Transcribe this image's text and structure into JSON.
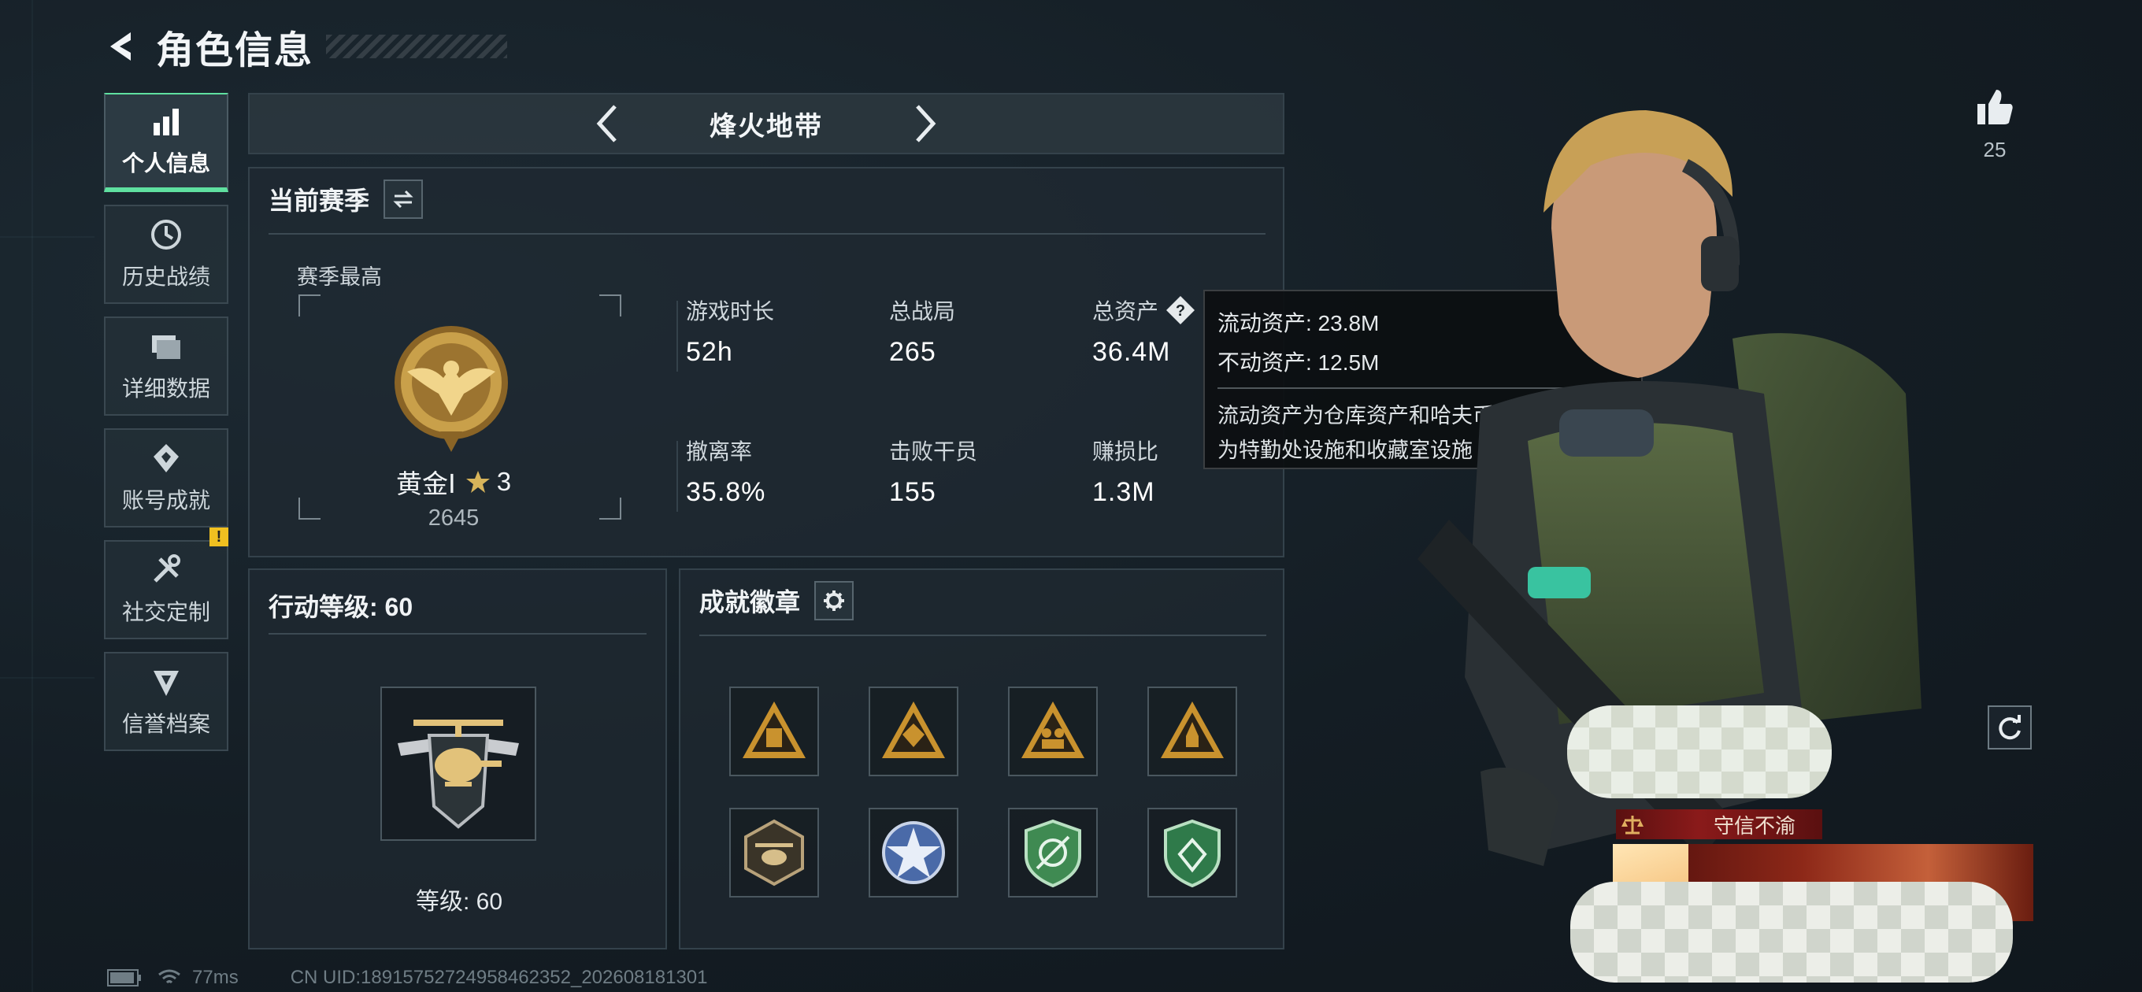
{
  "header": {
    "title": "角色信息"
  },
  "sidebar": {
    "items": [
      {
        "label": "个人信息",
        "icon": "bar-chart-icon",
        "active": true
      },
      {
        "label": "历史战绩",
        "icon": "clock-icon"
      },
      {
        "label": "详细数据",
        "icon": "folder-icon"
      },
      {
        "label": "账号成就",
        "icon": "achievement-icon"
      },
      {
        "label": "社交定制",
        "icon": "tools-icon",
        "badge": "!"
      },
      {
        "label": "信誉档案",
        "icon": "reputation-icon"
      }
    ]
  },
  "mode": {
    "name": "烽火地带"
  },
  "season": {
    "title": "当前赛季",
    "best_label": "赛季最高",
    "rank_name": "黄金Ⅰ",
    "rank_stars": "3",
    "rank_score": "2645",
    "stats": [
      {
        "label": "游戏时长",
        "value": "52h"
      },
      {
        "label": "总战局",
        "value": "265"
      },
      {
        "label": "总资产",
        "value": "36.4M"
      },
      {
        "label": "撤离率",
        "value": "35.8%"
      },
      {
        "label": "击败干员",
        "value": "155"
      },
      {
        "label": "赚损比",
        "value": "1.3M"
      }
    ]
  },
  "tooltip": {
    "liquid": "流动资产: 23.8M",
    "fixed": "不动资产: 12.5M",
    "desc_line1": "流动资产为仓库资产和哈夫币，不动资产",
    "desc_line2": "为特勤处设施和收藏室设施"
  },
  "level": {
    "title": "行动等级: 60",
    "label": "等级: 60"
  },
  "badges": {
    "title": "成就徽章"
  },
  "right": {
    "likes": "25",
    "tag": "守信不渝"
  },
  "footer": {
    "ping": "77ms",
    "uid": "CN UID:18915752724958462352_202608181301"
  },
  "colors": {
    "accent": "#5fe0a0",
    "gold": "#c9a04a",
    "warning": "#f0c020"
  }
}
